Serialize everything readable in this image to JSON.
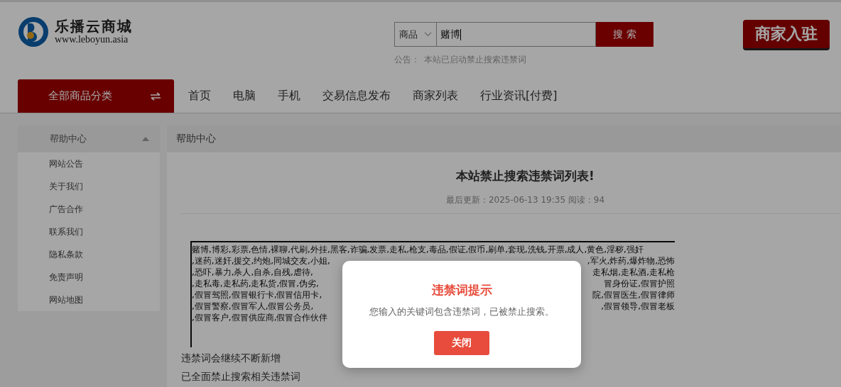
{
  "logo": {
    "name": "乐播云商城",
    "url": "www.leboyun.asia"
  },
  "search": {
    "scope": "商品",
    "value": "赌博",
    "button": "搜 索",
    "notice_label": "公告：",
    "notice": "本站已启动禁止搜索违禁词"
  },
  "merchant_button": "商家入驻",
  "nav": {
    "category": "全部商品分类",
    "links": [
      "首页",
      "电脑",
      "手机",
      "交易信息发布",
      "商家列表",
      "行业资讯[付费]"
    ]
  },
  "sidebar": {
    "title": "帮助中心",
    "expanded": true,
    "items": [
      "网站公告",
      "关于我们",
      "广告合作",
      "联系我们",
      "隐私条款",
      "免责声明",
      "网站地图"
    ]
  },
  "content": {
    "breadcrumb": "帮助中心",
    "title": "本站禁止搜索违禁词列表!",
    "meta": "最后更新：2025-06-13 19:35 阅读：94",
    "word_list": [
      {
        "left": "赌博,博彩,彩票,色情,裸聊,代刷,外挂,黑客,诈骗,发票,走私,枪支,毒品,假证,假币,刷单,套现,洗钱,开票,成人,黄色,淫秽,强奸"
      },
      {
        "left": ",迷药,迷奸,援交,约炮,同城交友,小姐,",
        "right": ",军火,炸药,爆炸物,恐怖"
      },
      {
        "left": ",恐吓,暴力,杀人,自杀,自残,虐待,",
        "right": "走私烟,走私酒,走私枪"
      },
      {
        "left": ",走私毒,走私药,走私货,假冒,伪劣,",
        "right": "冒身份证,假冒护照"
      },
      {
        "left": ",假冒驾照,假冒银行卡,假冒信用卡,",
        "right": "院,假冒医生,假冒律师"
      },
      {
        "left": ",假冒警察,假冒军人,假冒公务员,",
        "right": ",假冒领导,假冒老板"
      },
      {
        "left": ",假冒客户,假冒供应商,假冒合作伙伴"
      }
    ],
    "paragraphs": [
      "违禁词会继续不断新增",
      "已全面禁止搜索相关违禁词"
    ]
  },
  "dialog": {
    "title": "违禁词提示",
    "message": "您输入的关键词包含违禁词，已被禁止搜索。",
    "button": "关闭"
  }
}
